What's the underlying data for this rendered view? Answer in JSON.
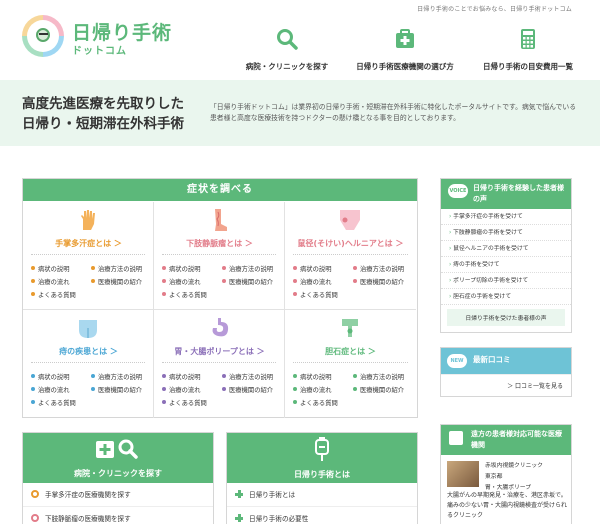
{
  "topnote": "日帰り手術のことでお悩みなら、日帰り手術ドットコム",
  "logo": {
    "title": "日帰り手術",
    "sub": "ドットコム"
  },
  "gnav": [
    {
      "label": "病院・クリニックを探す",
      "icon": "search-icon"
    },
    {
      "label": "日帰り手術医療機関の選び方",
      "icon": "medical-kit-icon"
    },
    {
      "label": "日帰り手術の目安費用一覧",
      "icon": "calculator-icon"
    }
  ],
  "hero": {
    "title_line1": "高度先進医療を先取りした",
    "title_line2": "日帰り・短期滞在外科手術",
    "desc": "「日帰り手術ドットコム」は業界初の日帰り手術・短期滞在外科手術に特化したポータルサイトです。病気で悩んでいる患者様と高度な医療技術を持つドクターの懸け橋となる事を目的としております。"
  },
  "symptoms": {
    "heading": "症状を調べる",
    "items": [
      {
        "title": "手掌多汗症とは ＞",
        "color": "orange",
        "art": "hand-icon",
        "links": [
          "病状の説明",
          "治療方法の説明",
          "治療の流れ",
          "医療機関の紹介",
          "よくある質問"
        ]
      },
      {
        "title": "下肢静脈瘤とは ＞",
        "color": "pink",
        "art": "leg-icon",
        "links": [
          "病状の説明",
          "治療方法の説明",
          "治療の流れ",
          "医療機関の紹介",
          "よくある質問"
        ]
      },
      {
        "title": "鼠径(そけい)ヘルニアとは ＞",
        "color": "pink",
        "art": "groin-icon",
        "links": [
          "病状の説明",
          "治療方法の説明",
          "治療の流れ",
          "医療機関の紹介",
          "よくある質問"
        ]
      },
      {
        "title": "痔の疾患とは ＞",
        "color": "blue",
        "art": "buttocks-icon",
        "links": [
          "病状の説明",
          "治療方法の説明",
          "治療の流れ",
          "医療機関の紹介",
          "よくある質問"
        ]
      },
      {
        "title": "胃・大腸ポリープとは ＞",
        "color": "purple",
        "art": "stomach-icon",
        "links": [
          "病状の説明",
          "治療方法の説明",
          "治療の流れ",
          "医療機関の紹介",
          "よくある質問"
        ]
      },
      {
        "title": "胆石症とは ＞",
        "color": "green",
        "art": "gallbladder-icon",
        "links": [
          "病状の説明",
          "治療方法の説明",
          "治療の流れ",
          "医療機関の紹介",
          "よくある質問"
        ]
      }
    ]
  },
  "find_box": {
    "heading": "病院・クリニックを探す",
    "items": [
      "手掌多汗症の医療機関を探す",
      "下肢静脈瘤の医療機関を探す"
    ]
  },
  "about_box": {
    "heading": "日帰り手術とは",
    "items": [
      "日帰り手術とは",
      "日帰り手術の必要性"
    ]
  },
  "voices": {
    "badge": "VOICE",
    "heading": "日帰り手術を経験した患者様の声",
    "items": [
      "手掌多汗症の手術を受けて",
      "下肢静脈瘤の手術を受けて",
      "鼠径ヘルニアの手術を受けて",
      "痔の手術を受けて",
      "ポリープ切除の手術を受けて",
      "胆石症の手術を受けて"
    ],
    "more": "日帰り手術を受けた患者様の声"
  },
  "kuchikomi": {
    "badge": "NEW",
    "heading": "最新口コミ",
    "link": "＞ 口コミ一覧を見る"
  },
  "clinic": {
    "heading": "遠方の患者様対応可能な医療機関",
    "name": "赤坂内視鏡クリニック",
    "area": "東京都",
    "type": "胃・大腸ポリープ",
    "desc": "大腸がんの早期発見・治療を、港区赤坂で。痛みの少ない胃・大腸内視鏡検査が受けられるクリニック"
  },
  "colors": {
    "brand": "#5cb87a",
    "hero_bg": "#eaf6ee",
    "kuchikomi": "#6ec3d6"
  }
}
